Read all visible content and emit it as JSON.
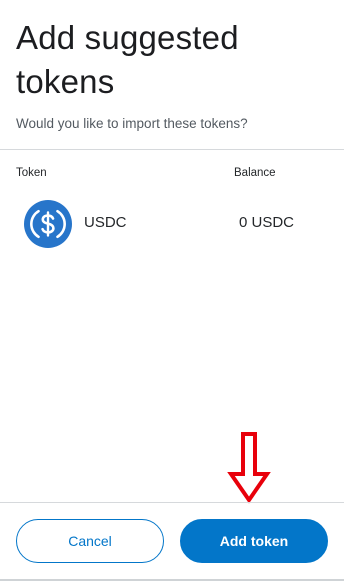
{
  "header": {
    "title": "Add suggested tokens",
    "subtitle": "Would you like to import these tokens?"
  },
  "table": {
    "columns": [
      "Token",
      "Balance"
    ],
    "rows": [
      {
        "icon": "usdc-icon",
        "symbol": "USDC",
        "balance": "0 USDC"
      }
    ]
  },
  "footer": {
    "cancel_label": "Cancel",
    "add_label": "Add token"
  },
  "colors": {
    "accent": "#0376c9",
    "usdc": "#2775ca",
    "annotation": "#e8000b"
  }
}
